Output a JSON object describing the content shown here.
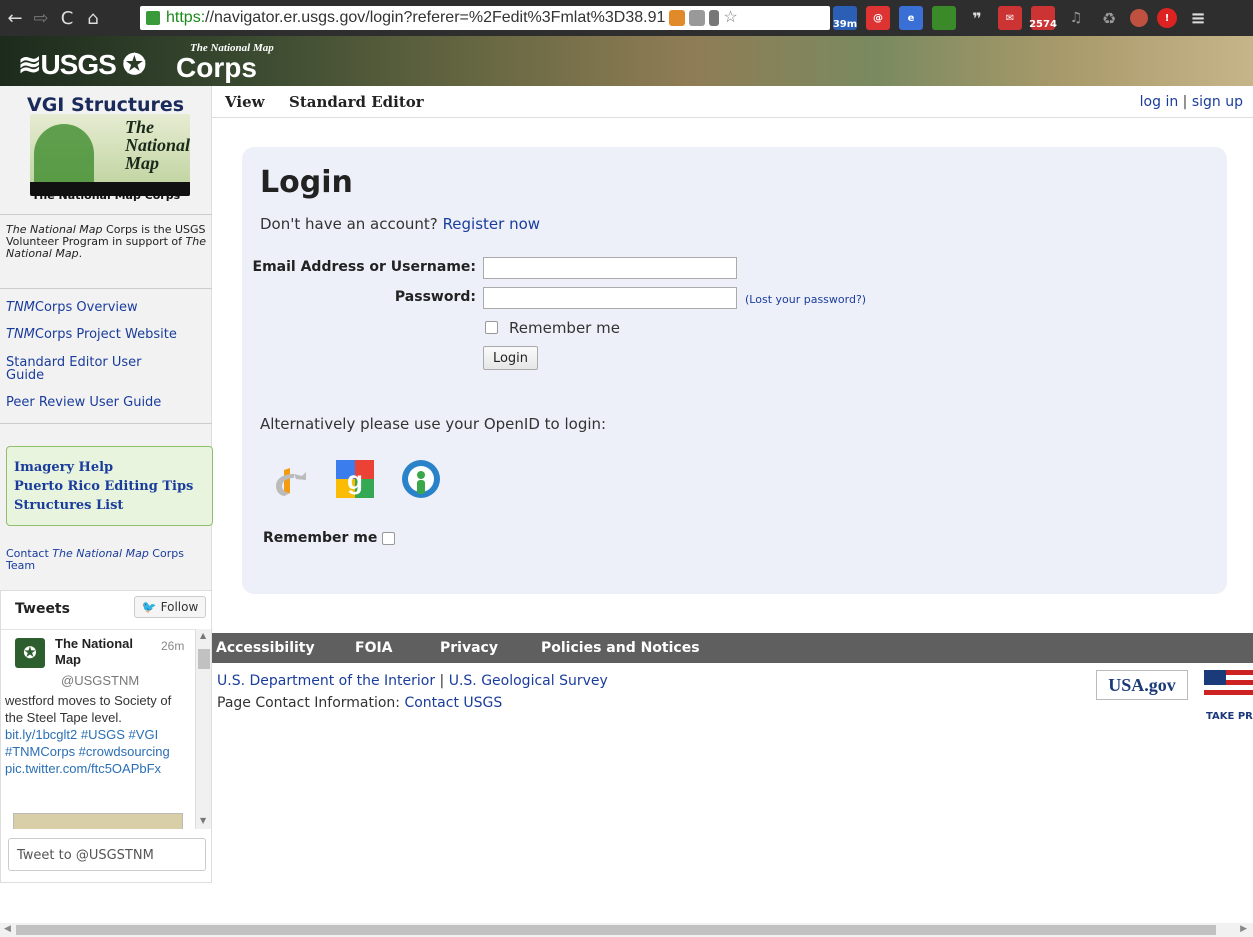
{
  "browser": {
    "url_https": "https:",
    "url_rest": "//navigator.er.usgs.gov/login?referer=%2Fedit%3Fmlat%3D38.91",
    "nav_icons": [
      "back-icon",
      "forward-icon",
      "reload-icon",
      "home-icon"
    ],
    "ext_badge_1": "39m",
    "ext_badge_2": "2574"
  },
  "banner": {
    "logo": "≋USGS ✪",
    "tnm": "The National Map",
    "corps": "Corps"
  },
  "sidebar": {
    "title": "VGI Structures",
    "logo_text_1": "The",
    "logo_text_2": "National",
    "logo_text_3": "Map",
    "logo_caption": "The National Map Corps",
    "intro_1": "The National Map",
    "intro_2": " Corps is the USGS Volunteer Program in support of ",
    "intro_3": "The National Map",
    "intro_4": ".",
    "links": [
      {
        "italic": "TNM",
        "rest": "Corps Overview"
      },
      {
        "italic": "TNM",
        "rest": "Corps Project Website"
      },
      {
        "italic": "",
        "rest": "Standard Editor User Guide"
      },
      {
        "italic": "",
        "rest": "Peer Review User Guide"
      }
    ],
    "help_links": [
      "Imagery Help",
      "Puerto Rico Editing Tips",
      "Structures List"
    ],
    "contact_1": "Contact ",
    "contact_2": "The National Map",
    "contact_3": " Corps Team"
  },
  "tweets": {
    "header": "Tweets",
    "follow": "Follow",
    "name": "The National Map",
    "time": "26m",
    "handle": "@USGSTNM",
    "text_plain": "westford  moves to Society of the Steel Tape level.",
    "text_links": "bit.ly/1bcglt2 #USGS #VGI #TNMCorps #crowdsourcing pic.twitter.com/ftc5OAPbFx",
    "tweet_to": "Tweet to @USGSTNM"
  },
  "topnav": {
    "tab_view": "View",
    "tab_editor": "Standard Editor",
    "login": "log in",
    "sep": " | ",
    "signup": "sign up"
  },
  "login": {
    "heading": "Login",
    "no_account": "Don't have an account?",
    "register": "Register now",
    "email_label": "Email Address or Username:",
    "email_value": "",
    "password_label": "Password:",
    "password_value": "",
    "lost_password": "(Lost your password?)",
    "remember_label": "Remember me",
    "login_button": "Login",
    "alt_text": "Alternatively please use your OpenID to login:",
    "remember_label_2": "Remember me"
  },
  "footer": {
    "links": [
      "Accessibility",
      "FOIA",
      "Privacy",
      "Policies and Notices"
    ],
    "doi": "U.S. Department of the Interior",
    "sep": " | ",
    "usgs": "U.S. Geological Survey",
    "contact_prefix": "Page Contact Information: ",
    "contact_link": "Contact USGS",
    "usagov": "USA.gov",
    "takepride": "TAKE PRIDE IN AMERICA"
  }
}
